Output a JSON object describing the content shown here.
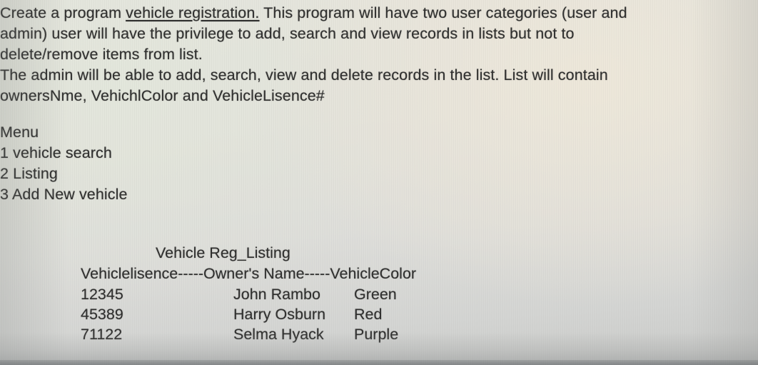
{
  "document": {
    "intro": {
      "line1_a": "Create a program ",
      "line1_underlined": "vehicle registration.",
      "line1_b": " This program will have two user categories (user and",
      "line2": "admin) user will have the privilege to add, search and view records in lists but not to",
      "line3": "delete/remove items from list."
    },
    "admin_paragraph": {
      "line1": "The admin will be able to add, search, view and delete records in the list. List will contain",
      "line2": "ownersNme, VehichlColor and VehicleLisence#"
    },
    "menu": {
      "heading": "Menu",
      "items": [
        "1 vehicle search",
        "2 Listing",
        "3 Add New vehicle"
      ]
    },
    "listing": {
      "title": "Vehicle Reg_Listing",
      "header_line": "Vehiclelisence-----Owner's Name-----VehicleColor",
      "columns": [
        "Vehiclelisence",
        "Owner's Name",
        "VehicleColor"
      ],
      "rows": [
        {
          "licence": "12345",
          "owner": "John Rambo",
          "color": "Green"
        },
        {
          "licence": "45389",
          "owner": "Harry Osburn",
          "color": "Red"
        },
        {
          "licence": "71122",
          "owner": "Selma Hyack",
          "color": "Purple"
        }
      ]
    },
    "colors": {
      "text": "#30302f",
      "page_light": "#e9e8e0",
      "page_dark": "#cbccca"
    }
  }
}
